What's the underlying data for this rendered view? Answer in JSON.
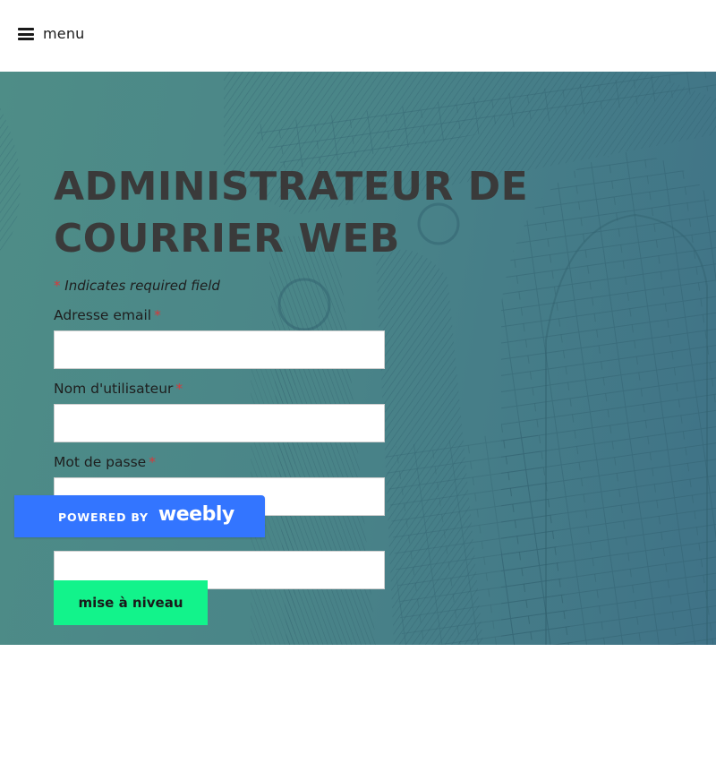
{
  "header": {
    "menu_label": "menu",
    "menu_icon": "hamburger-icon"
  },
  "hero": {
    "title": "ADMINISTRATEUR DE COURRIER WEB",
    "background": "engraving-illustration"
  },
  "form": {
    "required_asterisk": "*",
    "required_note": "Indicates required field",
    "fields": [
      {
        "label": "Adresse email",
        "value": "",
        "required": true
      },
      {
        "label": "Nom d'utilisateur",
        "value": "",
        "required": true
      },
      {
        "label": "Mot de passe",
        "value": "",
        "required": true
      },
      {
        "label": "",
        "value": "",
        "required": false
      }
    ],
    "submit_label": "mise à niveau"
  },
  "badge": {
    "powered_by": "POWERED BY",
    "brand": "weebly"
  },
  "colors": {
    "hero_gradient_start": "#4e8d87",
    "hero_gradient_end": "#3f7287",
    "button": "#12f38b",
    "badge": "#3375ff",
    "asterisk": "#d9383a",
    "title": "#3a3a3a"
  }
}
